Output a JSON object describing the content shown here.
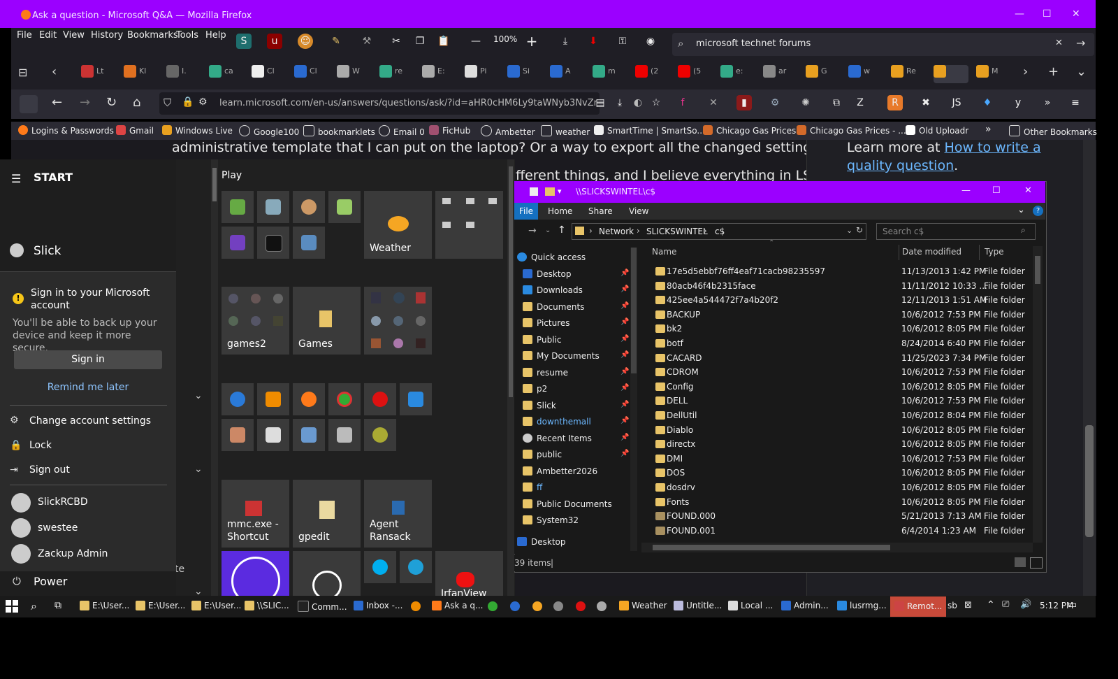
{
  "firefox": {
    "title": "Ask a question - Microsoft Q&A — Mozilla Firefox",
    "menu": [
      "File",
      "Edit",
      "View",
      "History",
      "Bookmarks",
      "Tools",
      "Help"
    ],
    "zoom": "100%",
    "search_value": "microsoft technet forums",
    "url": "learn.microsoft.com/en-us/answers/questions/ask/?id=aHR0cHM6Ly9taWNyb3NvZnQtZ",
    "tabs": [
      "Lt",
      "Kl",
      "I.",
      "ca",
      "Cl",
      "Cl",
      "W",
      "re",
      "E:",
      "Pi",
      "Si",
      "A",
      "m",
      "(2",
      "(5",
      "e:",
      "ar",
      "G",
      "w",
      "Re",
      "",
      "M"
    ],
    "bookmarks": [
      "Logins & Passwords",
      "Gmail",
      "Windows Live",
      "Google100",
      "bookmarklets",
      "Email 0",
      "FicHub",
      "Ambetter",
      "weather",
      "SmartTime | SmartSo...",
      "Chicago Gas Prices",
      "Chicago Gas Prices - ...",
      "Old Uploadr",
      "Other Bookmarks"
    ]
  },
  "page": {
    "line1": "administrative template that I can put on the laptop? Or a way to export all the changed settings?",
    "line2": "fferent things, and I believe everything in LSP",
    "side_prefix": "Learn more at ",
    "side_link": "How to write a quality question",
    "side_suffix": "."
  },
  "start": {
    "header": "START",
    "user": "Slick",
    "signin_title": "Sign in to your Microsoft account",
    "signin_desc": "You'll be able to back up your device and keep it more secure.",
    "signin_button": "Sign in",
    "remind": "Remind me later",
    "change_settings": "Change account settings",
    "lock": "Lock",
    "sign_out": "Sign out",
    "accounts": [
      "SlickRCBD",
      "swestee",
      "Zackup Admin"
    ],
    "power": "Power",
    "group_play": "Play",
    "tile_weather": "Weather",
    "tile_games2": "games2",
    "tile_games": "Games",
    "tile_mmc": "mmc.exe - Shortcut",
    "tile_gpedit": "gpedit",
    "tile_agent": "Agent Ransack",
    "tile_irfan": "IrfanView",
    "partial_te": "te"
  },
  "explorer": {
    "title": "\\\\SLICKSWINTEL\\c$",
    "ribbon": [
      "File",
      "Home",
      "Share",
      "View"
    ],
    "path": [
      "Network",
      "SLICKSWINTEL",
      "c$"
    ],
    "search_placeholder": "Search c$",
    "col_name": "Name",
    "col_date": "Date modified",
    "col_type": "Type",
    "nav": [
      "Quick access",
      "Desktop",
      "Downloads",
      "Documents",
      "Pictures",
      "Public",
      "My Documents",
      "resume",
      "p2",
      "Slick",
      "downthemall",
      "Recent Items",
      "public",
      "Ambetter2026",
      "ff",
      "Public Documents",
      "System32",
      "Desktop"
    ],
    "files": [
      {
        "name": "17e5d5ebbf76ff4eaf71cacb98235597",
        "date": "11/13/2013 1:42 PM",
        "type": "File folder"
      },
      {
        "name": "80acb46f4b2315face",
        "date": "11/11/2012 10:33 ...",
        "type": "File folder"
      },
      {
        "name": "425ee4a544472f7a4b20f2",
        "date": "12/11/2013 1:51 AM",
        "type": "File folder"
      },
      {
        "name": "BACKUP",
        "date": "10/6/2012 7:53 PM",
        "type": "File folder"
      },
      {
        "name": "bk2",
        "date": "10/6/2012 8:05 PM",
        "type": "File folder"
      },
      {
        "name": "botf",
        "date": "8/24/2014 6:40 PM",
        "type": "File folder"
      },
      {
        "name": "CACARD",
        "date": "11/25/2023 7:34 PM",
        "type": "File folder"
      },
      {
        "name": "CDROM",
        "date": "10/6/2012 7:53 PM",
        "type": "File folder"
      },
      {
        "name": "Config",
        "date": "10/6/2012 8:05 PM",
        "type": "File folder"
      },
      {
        "name": "DELL",
        "date": "10/6/2012 7:53 PM",
        "type": "File folder"
      },
      {
        "name": "DellUtil",
        "date": "10/6/2012 8:04 PM",
        "type": "File folder"
      },
      {
        "name": "Diablo",
        "date": "10/6/2012 8:05 PM",
        "type": "File folder"
      },
      {
        "name": "directx",
        "date": "10/6/2012 8:05 PM",
        "type": "File folder"
      },
      {
        "name": "DMI",
        "date": "10/6/2012 7:53 PM",
        "type": "File folder"
      },
      {
        "name": "DOS",
        "date": "10/6/2012 8:05 PM",
        "type": "File folder"
      },
      {
        "name": "dosdrv",
        "date": "10/6/2012 8:05 PM",
        "type": "File folder"
      },
      {
        "name": "Fonts",
        "date": "10/6/2012 8:05 PM",
        "type": "File folder"
      },
      {
        "name": "FOUND.000",
        "date": "5/21/2013 7:13 AM",
        "type": "File folder"
      },
      {
        "name": "FOUND.001",
        "date": "6/4/2014 1:23 AM",
        "type": "File folder"
      }
    ],
    "status": "39 items"
  },
  "taskbar": {
    "items": [
      "E:\\User...",
      "E:\\User...",
      "E:\\User...",
      "\\\\SLIC...",
      "Comm...",
      "Inbox -...",
      "Ask a q...",
      "Weather",
      "Untitle...",
      "Local ...",
      "Admin...",
      "lusrmg...",
      "Remot..."
    ],
    "tray_sb": "sb",
    "time": "5:12 PM"
  }
}
